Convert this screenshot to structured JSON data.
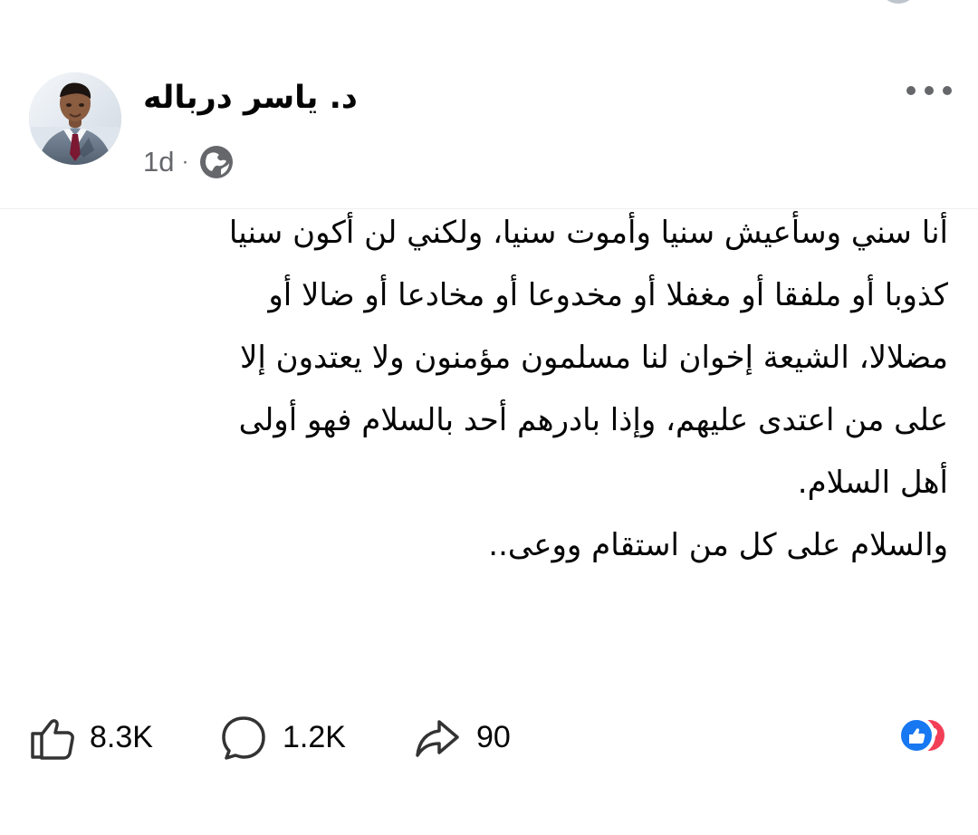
{
  "post": {
    "author": "د. ياسر درباله",
    "time": "1d",
    "meta_separator": "·",
    "privacy_icon": "globe-icon",
    "menu_icon": "more-options-icon",
    "body_lines": [
      "أنا سني وسأعيش سنيا وأموت سنيا، ولكني لن أكون سنيا",
      "كذوبا أو ملفقا أو مغفلا أو مخدوعا أو مخادعا أو ضالا أو",
      "مضلالا، الشيعة إخوان لنا  مسلمون مؤمنون ولا يعتدون إلا",
      "على من اعتدى عليهم،  وإذا بادرهم أحد بالسلام فهو أولى",
      "أهل السلام."
    ],
    "closing_line": "والسلام على كل من استقام ووعى.."
  },
  "actions": {
    "likes": "8.3K",
    "comments": "1.2K",
    "shares": "90",
    "like_icon": "thumbs-up-icon",
    "comment_icon": "comment-bubble-icon",
    "share_icon": "share-arrow-icon"
  },
  "reactions": [
    {
      "name": "like",
      "icon": "like-reaction-icon",
      "color": "#1778f2"
    },
    {
      "name": "love",
      "icon": "love-reaction-icon",
      "color": "#f33e58"
    }
  ],
  "colors": {
    "text": "#050505",
    "secondary_text": "#65676b",
    "divider": "#eeeeee",
    "like_blue": "#1778f2",
    "love_red": "#f33e58"
  }
}
